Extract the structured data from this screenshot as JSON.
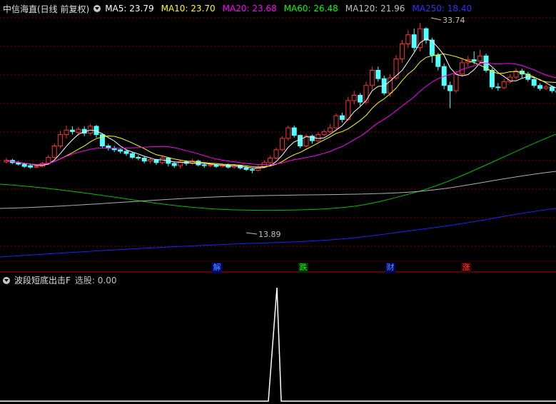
{
  "header": {
    "title": "中信海直(日线 前复权)",
    "ma": [
      {
        "label": "MA5: 23.79",
        "color": "#ffffff"
      },
      {
        "label": "MA10: 23.70",
        "color": "#ffff00"
      },
      {
        "label": "MA20: 23.68",
        "color": "#ff00ff"
      },
      {
        "label": "MA60: 26.48",
        "color": "#00ff00"
      },
      {
        "label": "MA120: 21.96",
        "color": "#c0c0c0"
      },
      {
        "label": "MA250: 18.40",
        "color": "#3030ff"
      }
    ]
  },
  "annotations": {
    "high": "33.74",
    "low": "13.89"
  },
  "events": [
    {
      "label": "解",
      "color": "#40a0ff",
      "bg": "#000080"
    },
    {
      "label": "跌",
      "color": "#00ff00",
      "bg": "#003000"
    },
    {
      "label": "财",
      "color": "#40a0ff",
      "bg": "#000060"
    },
    {
      "label": "涨",
      "color": "#ff4040",
      "bg": "#400000"
    }
  ],
  "indicator": {
    "title": "波段短底出击F",
    "value": "选股: 0.00"
  },
  "colors": {
    "up": "#ff3232",
    "down": "#54ffff",
    "grid": "#800000",
    "spike": "#ffffff"
  }
}
